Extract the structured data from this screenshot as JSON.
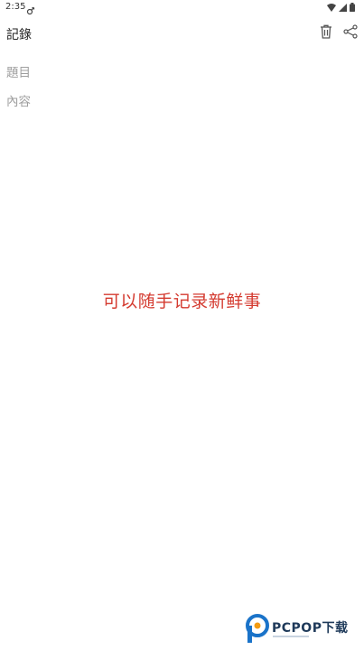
{
  "status_bar": {
    "time": "2:35",
    "left_icon": "usb-debug-icon",
    "right_icons": [
      "wifi-icon",
      "cellular-signal-icon",
      "battery-icon"
    ]
  },
  "toolbar": {
    "title": "記錄",
    "delete_icon": "trash-icon",
    "share_icon": "share-icon"
  },
  "editor": {
    "title_placeholder": "題目",
    "content_placeholder": "內容"
  },
  "promo": {
    "caption": "可以随手记录新鲜事",
    "color": "#d43a2f"
  },
  "watermark": {
    "brand": "PCPOP下载",
    "logo_color": "#1a73c9",
    "text_color": "#1f3a5a"
  }
}
